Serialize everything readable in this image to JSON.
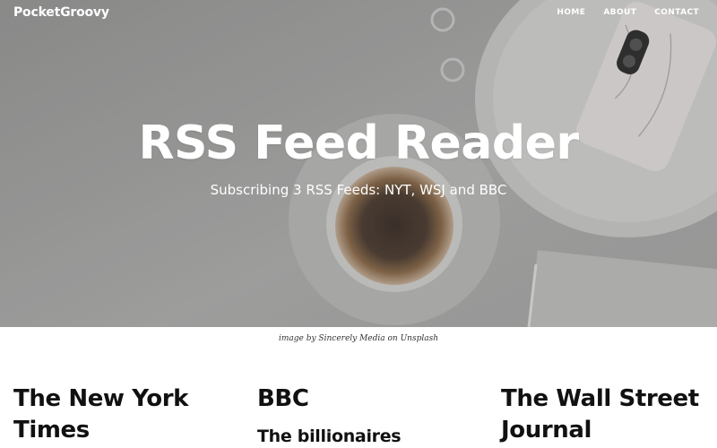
{
  "navbar": {
    "brand": "PocketGroovy",
    "links": [
      "HOME",
      "ABOUT",
      "CONTACT"
    ]
  },
  "hero": {
    "title": "RSS Feed Reader",
    "subtitle": "Subscribing 3 RSS Feeds: NYT, WSJ and BBC"
  },
  "caption": "image by Sincerely Media on Unsplash",
  "feeds": [
    {
      "title": "The New York Times"
    },
    {
      "title": "BBC",
      "first_item": "The billionaires"
    },
    {
      "title": "The Wall Street Journal"
    }
  ]
}
